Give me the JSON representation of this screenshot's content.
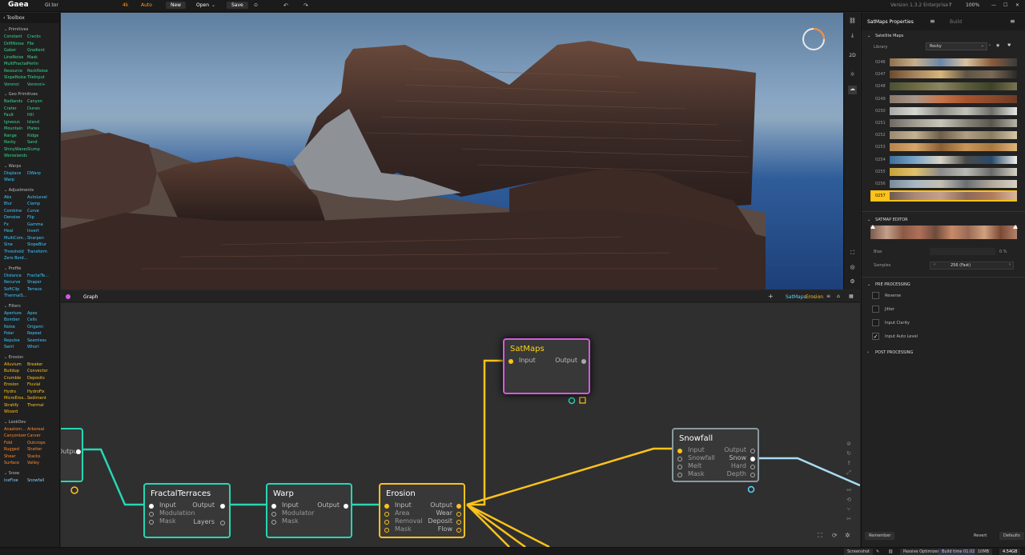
{
  "topbar": {
    "app_name": "Gaea",
    "file": "GI.tor",
    "resolution": "4k",
    "mode": "Auto",
    "new_label": "New",
    "open_label": "Open",
    "save_label": "Save",
    "version": "Version 1.3.2 Enterprise",
    "zoom": "100%"
  },
  "toolbox": {
    "title": "Toolbox",
    "categories": [
      {
        "name": "Primitives",
        "color": "#39d98a",
        "items": [
          "Constant",
          "Cracks",
          "DriftNoise",
          "File",
          "Gabor",
          "Gradient",
          "LineNoise",
          "Mask",
          "MultiFractal",
          "Perlin",
          "Resource",
          "RockNoise",
          "SlopeNoise",
          "TileInput",
          "Voronoi",
          "Voronoi+"
        ]
      },
      {
        "name": "Geo Primitives",
        "color": "#39d98a",
        "items": [
          "Badlands",
          "Canyon",
          "Crater",
          "Dunes",
          "Fault",
          "Hill",
          "Igneous",
          "Island",
          "Mountain",
          "Plates",
          "Range",
          "Ridge",
          "Rocky",
          "Sand",
          "ShinyWaves",
          "Slump",
          "Worselands",
          ""
        ]
      },
      {
        "name": "Warps",
        "color": "#3ec9ff",
        "items": [
          "Displace",
          "DWarp",
          "Warp",
          ""
        ]
      },
      {
        "name": "Adjustments",
        "color": "#3ec9ff",
        "items": [
          "Abs",
          "AutoLevel",
          "Blur",
          "Clamp",
          "Combine",
          "Curve",
          "Denoise",
          "Flip",
          "Fx",
          "Gamma",
          "Heal",
          "Invert",
          "MultiCom...",
          "Sharpen",
          "Sine",
          "SlopeBlur",
          "Threshold",
          "Transform",
          "Zero Bord...",
          ""
        ]
      },
      {
        "name": "Profile",
        "color": "#3ec9ff",
        "items": [
          "Distance",
          "FractalTe...",
          "Recurve",
          "Shaper",
          "SoftClip",
          "Terrace",
          "ThermalS...",
          ""
        ]
      },
      {
        "name": "Filters",
        "color": "#3ec9ff",
        "items": [
          "Aperture",
          "Apex",
          "Bomber",
          "Cells",
          "Noise",
          "Origami",
          "Polar",
          "Repeat",
          "Repulse",
          "Seamless",
          "Swirl",
          "Whorl"
        ]
      },
      {
        "name": "Erosion",
        "color": "#ffc21a",
        "items": [
          "Alluvium",
          "Breaker",
          "Buildup",
          "Convector",
          "Crumble",
          "Deposits",
          "Erosion",
          "Fluvial",
          "Hydro",
          "HydroFix",
          "MicroEros...",
          "Sediment",
          "Stratify",
          "Thermal",
          "Wizard",
          ""
        ]
      },
      {
        "name": "LookDev",
        "color": "#ff8a2b",
        "items": [
          "Anastom...",
          "Arboreal",
          "Canyonizer",
          "Carver",
          "Fold",
          "Outcrops",
          "Rugged",
          "Shatter",
          "Shear",
          "Stacks",
          "Surface",
          "Valley"
        ]
      },
      {
        "name": "Snow",
        "color": "#7fd2ff",
        "items": [
          "IceFloe",
          "Snowfall"
        ]
      }
    ]
  },
  "graph": {
    "tab": "Graph",
    "breadcrumb_1": "SatMaps",
    "breadcrumb_2": "Erosion",
    "nodes": {
      "fractal": {
        "title": "FractalTerraces",
        "ports_in": [
          "Input",
          "Modulation",
          "Mask"
        ],
        "ports_out": [
          "Output",
          "Layers"
        ]
      },
      "warp": {
        "title": "Warp",
        "ports_in": [
          "Input",
          "Modulator",
          "Mask"
        ],
        "ports_out": [
          "Output"
        ]
      },
      "erosion": {
        "title": "Erosion",
        "ports_in": [
          "Input",
          "Area",
          "Removal",
          "Mask"
        ],
        "ports_out": [
          "Output",
          "Wear",
          "Deposit",
          "Flow"
        ]
      },
      "satmaps": {
        "title": "SatMaps",
        "ports_in": [
          "Input"
        ],
        "ports_out": [
          "Output"
        ]
      },
      "snowfall": {
        "title": "Snowfall",
        "ports_in": [
          "Input",
          "Snowfall",
          "Melt",
          "Mask"
        ],
        "ports_out": [
          "Output",
          "Snow",
          "Hard",
          "Depth"
        ]
      },
      "partial_port": "Output"
    },
    "colors": {
      "cyan": "#27d6b2",
      "yellow": "#ffc21a",
      "magenta": "#d659e0",
      "grey": "#8a9aa0",
      "lightblue": "#a8dcf0"
    }
  },
  "properties": {
    "tab_active": "SatMaps Properties",
    "tab_other": "Build",
    "section_satellite": "Satellite Maps",
    "library_label": "Library",
    "library_value": "Rocky",
    "swatches": [
      {
        "id": "0246",
        "colors": [
          "#8f6f4e",
          "#c7b08a",
          "#6b86a8",
          "#d9c2a0",
          "#8a5b3b",
          "#3b3b3b"
        ]
      },
      {
        "id": "0247",
        "colors": [
          "#6b4b2e",
          "#a5845c",
          "#d9b57b",
          "#5f5543",
          "#7a6a55",
          "#2a2a26"
        ]
      },
      {
        "id": "0248",
        "colors": [
          "#4a5133",
          "#6d6a44",
          "#8a8560",
          "#5c5c3c",
          "#3d4228",
          "#7a7452"
        ]
      },
      {
        "id": "0249",
        "colors": [
          "#8a7a6b",
          "#a9968a",
          "#c7754a",
          "#a7532f",
          "#8c4a2c",
          "#6e3b26"
        ]
      },
      {
        "id": "0250",
        "colors": [
          "#a9a9a6",
          "#d6d6d2",
          "#8c8b86",
          "#c4c2bb",
          "#6e6d69",
          "#e9e8e2"
        ]
      },
      {
        "id": "0251",
        "colors": [
          "#6e6a63",
          "#a19d93",
          "#c7c4b9",
          "#8a857b",
          "#5a564f",
          "#b7b3a8"
        ]
      },
      {
        "id": "0252",
        "colors": [
          "#9a8a72",
          "#c4b293",
          "#6d5e4b",
          "#b19f83",
          "#8a7b64",
          "#d8c7a8"
        ]
      },
      {
        "id": "0253",
        "colors": [
          "#b7854c",
          "#d6a56a",
          "#8a5f34",
          "#c79558",
          "#a9783f",
          "#e0b27a"
        ]
      },
      {
        "id": "0254",
        "colors": [
          "#3d6d9a",
          "#7aa5c7",
          "#d9d4c4",
          "#4a4a4a",
          "#2a4a6a",
          "#f0f0ea"
        ]
      },
      {
        "id": "0255",
        "colors": [
          "#c7a33b",
          "#e0c06b",
          "#8a8a8a",
          "#b9b9b4",
          "#6a6a6a",
          "#d6d2c4"
        ]
      },
      {
        "id": "0256",
        "colors": [
          "#7a8a9a",
          "#a9b7c4",
          "#c4bfb4",
          "#6a6f75",
          "#b0a89a",
          "#d9d2c4"
        ]
      },
      {
        "id": "0257",
        "colors": [
          "#6e5a4e",
          "#a98a78",
          "#c4a08a",
          "#8a6a5a",
          "#b07a5a",
          "#d9b7a0"
        ]
      }
    ],
    "selected_swatch": "0257",
    "section_editor": "SATMAP EDITOR",
    "editor_colors": [
      "#7a5a4e",
      "#c4a08a",
      "#8a5a44",
      "#b0705a",
      "#6e4a3b",
      "#c78a6a",
      "#9a6a55",
      "#d0a080",
      "#7a4a35",
      "#b7826a"
    ],
    "bias_label": "Bias",
    "bias_value": "0 %",
    "samples_label": "Samples",
    "samples_value": "256 (Fast)",
    "section_pre": "PRE PROCESSING",
    "pre_items": [
      {
        "label": "Reverse",
        "checked": false
      },
      {
        "label": "Jitter",
        "checked": false
      },
      {
        "label": "Input Clarity",
        "checked": false
      },
      {
        "label": "Input Auto Level",
        "checked": true
      }
    ],
    "section_post": "POST PROCESSING",
    "remember_label": "Remember",
    "revert_label": "Revert",
    "defaults_label": "Defaults"
  },
  "viewport_rail": {
    "label_2d": "2D"
  },
  "statusbar": {
    "screenshot": "Screenshot",
    "optimizer": "Passive Optimizer",
    "build_time": "Build time 01.02",
    "mem1": "10MB",
    "mem2": "4.54GB"
  }
}
